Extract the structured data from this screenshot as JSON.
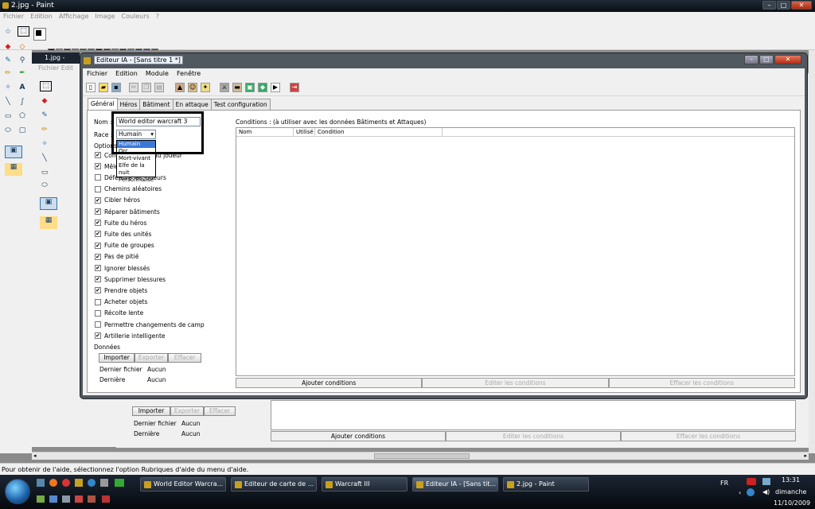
{
  "paint": {
    "title": "2.jpg - Paint",
    "menu": [
      "Fichier",
      "Edition",
      "Affichage",
      "Image",
      "Couleurs",
      "?"
    ],
    "status": "Pour obtenir de l'aide, sélectionnez l'option Rubriques d'aide du menu d'aide.",
    "palette": [
      "#000000",
      "#808080",
      "#800000",
      "#808000",
      "#008000",
      "#008080",
      "#000080",
      "#800080",
      "#808040",
      "#004040",
      "#0080ff",
      "#004080",
      "#8000ff",
      "#804000",
      "#ffffff",
      "#c0c0c0",
      "#ff0000",
      "#ffff00",
      "#00ff00",
      "#00ffff",
      "#0000ff",
      "#ff00ff",
      "#ffff80",
      "#00ff80",
      "#80ffff",
      "#8080ff",
      "#ff0080",
      "#ff8040"
    ]
  },
  "back_window": {
    "title": "1.jpg - Paint",
    "menu": "Fichier  Edit",
    "importer": "Importer",
    "exporter": "Exporter",
    "effacer": "Effacer",
    "dernier_fichier_label": "Dernier fichier",
    "dernier_fichier_value": "Aucun",
    "derniere_label": "Dernière",
    "derniere_value": "Aucun",
    "ajouter": "Ajouter conditions",
    "editer": "Editer les conditions",
    "effacer_cond": "Effacer les conditions"
  },
  "editor": {
    "title": "Editeur IA - [Sans titre 1 *]",
    "menu": [
      "Fichier",
      "Edition",
      "Module",
      "Fenêtre"
    ],
    "tabs": [
      "Général",
      "Héros",
      "Bâtiment",
      "En attaque",
      "Test configuration"
    ],
    "nom_label": "Nom :",
    "nom_value": "World editor warcraft 3",
    "race_label": "Race :",
    "race_value": "Humain",
    "race_options": [
      "Humain",
      "Orc",
      "Mort-vivant",
      "Elfe de la nuit",
      "Personnalisé"
    ],
    "options_label": "Options",
    "options": [
      {
        "label": "Confier contrôle au joueur",
        "checked": true
      },
      {
        "label": "Mêlée",
        "checked": true
      },
      {
        "label": "Défendre les joueurs",
        "checked": false
      },
      {
        "label": "Chemins aléatoires",
        "checked": false
      },
      {
        "label": "Cibler héros",
        "checked": true
      },
      {
        "label": "Réparer bâtiments",
        "checked": true
      },
      {
        "label": "Fuite du héros",
        "checked": true
      },
      {
        "label": "Fuite des unités",
        "checked": true
      },
      {
        "label": "Fuite de groupes",
        "checked": true
      },
      {
        "label": "Pas de pitié",
        "checked": true
      },
      {
        "label": "Ignorer blessés",
        "checked": true
      },
      {
        "label": "Supprimer blessures",
        "checked": true
      },
      {
        "label": "Prendre objets",
        "checked": true
      },
      {
        "label": "Acheter objets",
        "checked": false
      },
      {
        "label": "Récolte lente",
        "checked": false
      },
      {
        "label": "Permettre changements de camp",
        "checked": false
      },
      {
        "label": "Artillerie intelligente",
        "checked": true
      }
    ],
    "donnees_label": "Données",
    "importer": "Importer",
    "exporter": "Exporter",
    "effacer": "Effacer",
    "dernier_fichier_label": "Dernier fichier",
    "dernier_fichier_value": "Aucun",
    "derniere_label": "Dernière",
    "derniere_value": "Aucun",
    "conditions_label": "Conditions : (à utiliser avec les données Bâtiments et Attaques)",
    "columns": [
      "Nom",
      "Utilisé",
      "Condition"
    ],
    "ajouter": "Ajouter conditions",
    "editer": "Editer les conditions",
    "effacer_cond": "Effacer les conditions"
  },
  "taskbar": {
    "tasks": [
      "World Editor Warcra...",
      "Editeur de carte de ...",
      "Warcraft III",
      "Editeur IA - [Sans tit...",
      "2.jpg - Paint"
    ],
    "lang": "FR",
    "time": "13:31",
    "day": "dimanche",
    "date": "11/10/2009"
  }
}
